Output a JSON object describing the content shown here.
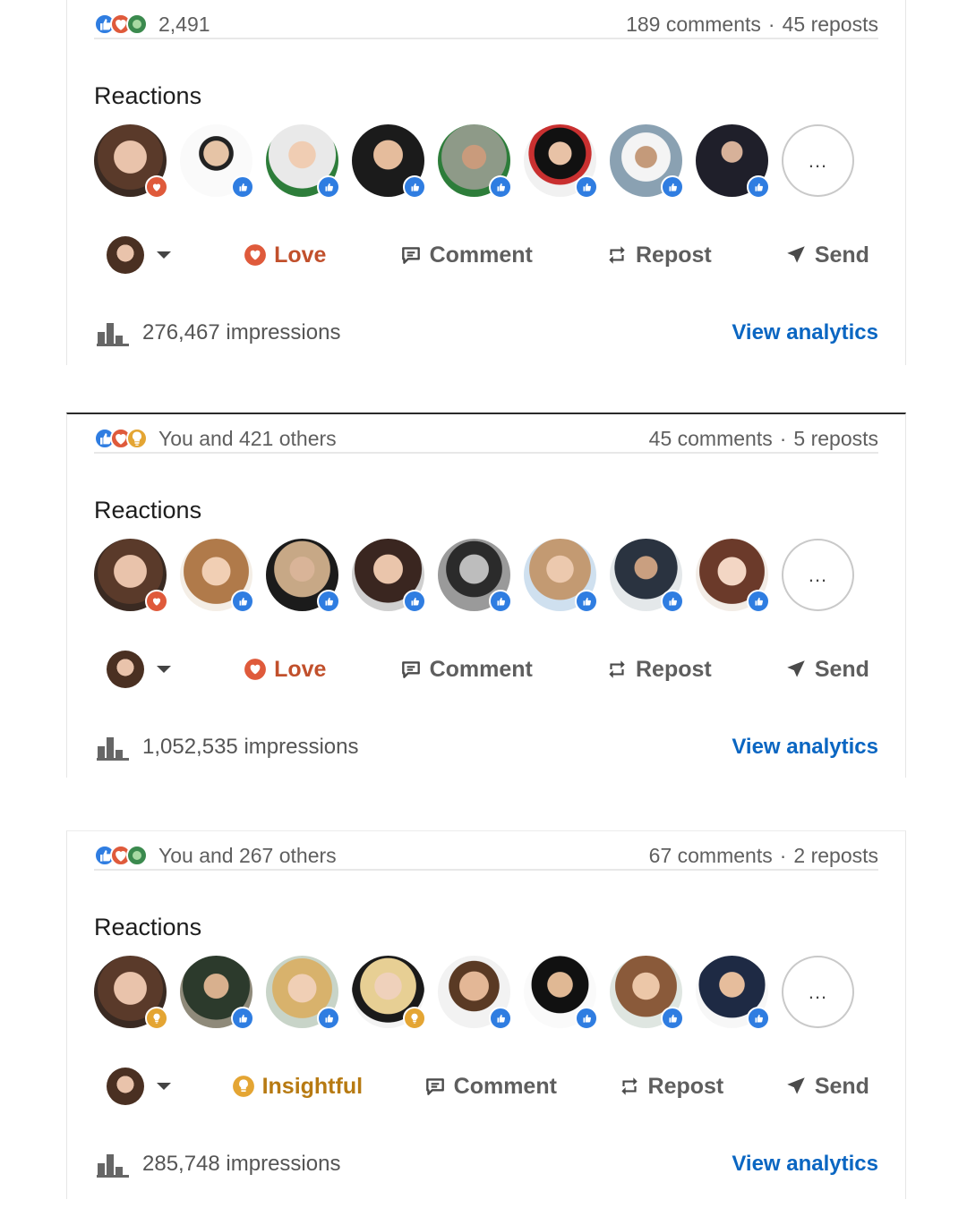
{
  "posts": [
    {
      "reaction_icons": [
        "like-icon",
        "celebrate-icon",
        "support-icon"
      ],
      "reaction_summary": "2,491",
      "comments": "189 comments",
      "reposts": "45 reposts",
      "reactions_title": "Reactions",
      "reactor_badges": [
        "love",
        "like",
        "like",
        "like",
        "like",
        "like",
        "like",
        "like"
      ],
      "more_label": "...",
      "my_reaction": "Love",
      "my_reaction_type": "love",
      "actions": {
        "comment": "Comment",
        "repost": "Repost",
        "send": "Send"
      },
      "impressions": "276,467 impressions",
      "view_analytics": "View analytics"
    },
    {
      "reaction_icons": [
        "like-icon",
        "love-icon",
        "insightful-icon"
      ],
      "reaction_summary": "You and 421 others",
      "comments": "45 comments",
      "reposts": "5 reposts",
      "reactions_title": "Reactions",
      "reactor_badges": [
        "love",
        "like",
        "like",
        "like",
        "like",
        "like",
        "like",
        "like"
      ],
      "more_label": "...",
      "my_reaction": "Love",
      "my_reaction_type": "love",
      "actions": {
        "comment": "Comment",
        "repost": "Repost",
        "send": "Send"
      },
      "impressions": "1,052,535 impressions",
      "view_analytics": "View analytics"
    },
    {
      "reaction_icons": [
        "like-icon",
        "love-icon",
        "support-icon"
      ],
      "reaction_summary": "You and 267 others",
      "comments": "67 comments",
      "reposts": "2 reposts",
      "reactions_title": "Reactions",
      "reactor_badges": [
        "insight",
        "like",
        "like",
        "insight",
        "like",
        "like",
        "like",
        "like"
      ],
      "more_label": "...",
      "my_reaction": "Insightful",
      "my_reaction_type": "insight",
      "actions": {
        "comment": "Comment",
        "repost": "Repost",
        "send": "Send"
      },
      "impressions": "285,748 impressions",
      "view_analytics": "View analytics"
    }
  ],
  "colors": {
    "link": "#0a66c2",
    "love": "#c1502c",
    "insight": "#b77a12",
    "like": "#2f7de1",
    "muted": "#5f5f5f"
  }
}
